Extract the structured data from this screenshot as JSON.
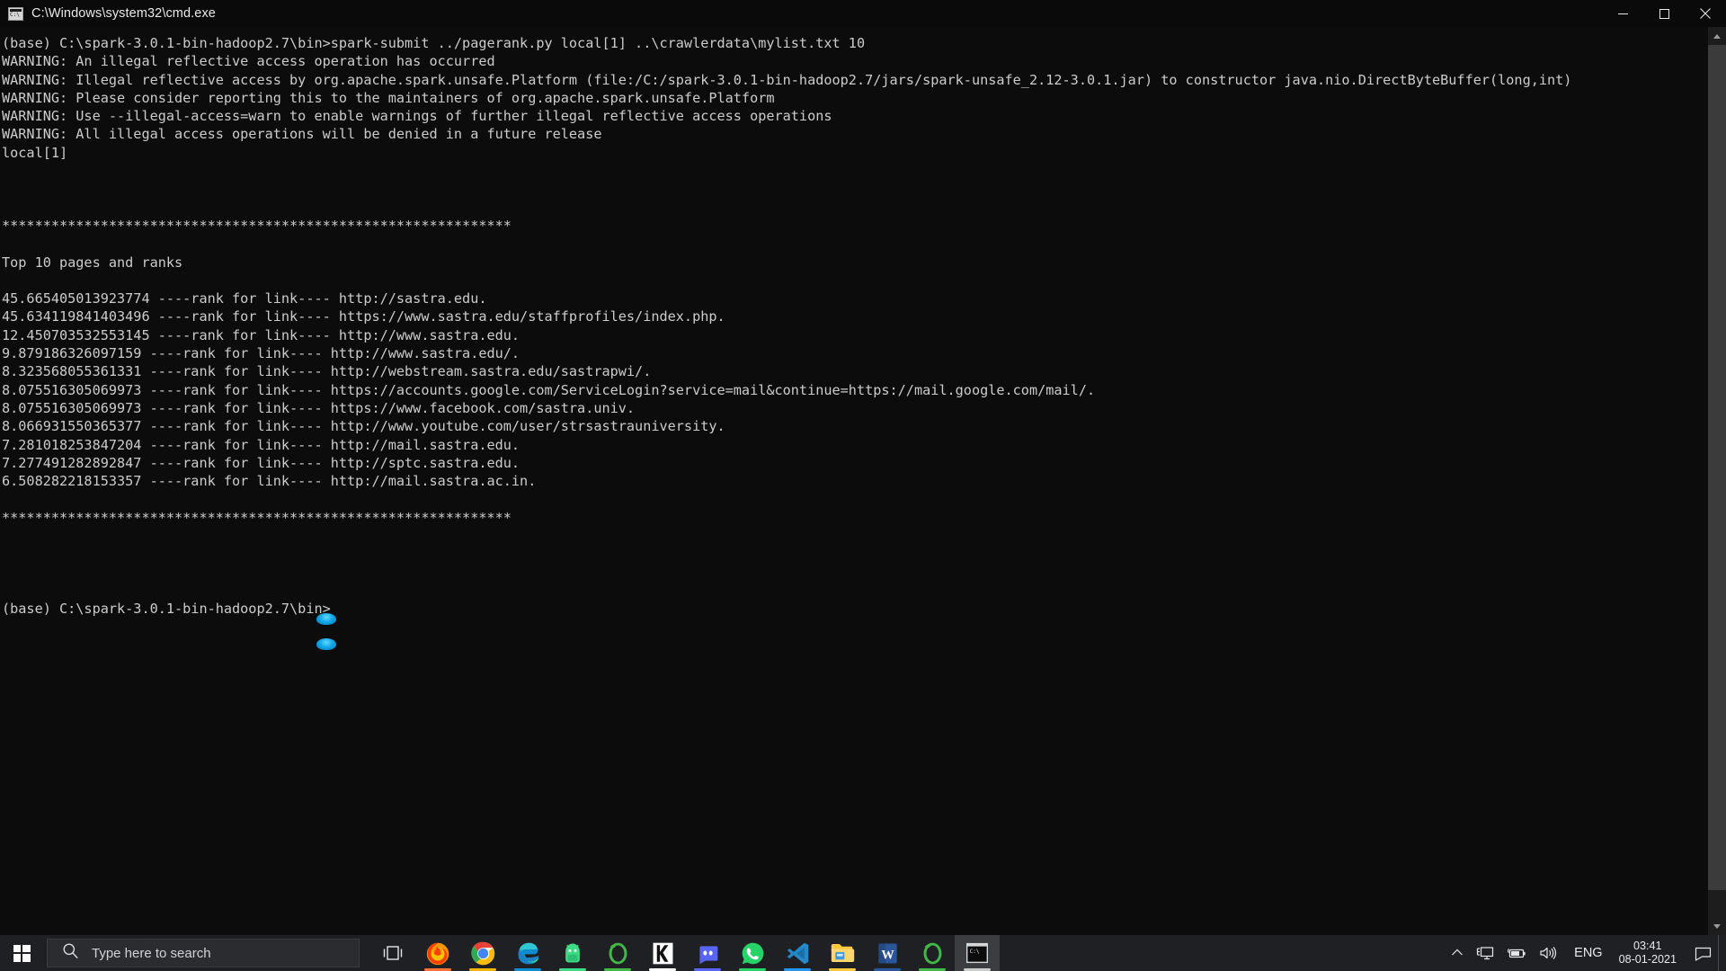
{
  "window": {
    "title": "C:\\Windows\\system32\\cmd.exe",
    "icon": "cmd-icon",
    "controls": [
      {
        "name": "minimize-button",
        "glyph": "minimize"
      },
      {
        "name": "maximize-button",
        "glyph": "maximize"
      },
      {
        "name": "close-button",
        "glyph": "close"
      }
    ]
  },
  "console": {
    "prompt_cwd": "(base) C:\\spark-3.0.1-bin-hadoop2.7\\bin>",
    "command": "spark-submit ../pagerank.py local[1] ..\\crawlerdata\\mylist.txt 10",
    "separator": "**************************************************************",
    "heading": "Top 10 pages and ranks",
    "warnings": [
      "WARNING: An illegal reflective access operation has occurred",
      "WARNING: Illegal reflective access by org.apache.spark.unsafe.Platform (file:/C:/spark-3.0.1-bin-hadoop2.7/jars/spark-unsafe_2.12-3.0.1.jar) to constructor java.nio.DirectByteBuffer(long,int)",
      "WARNING: Please consider reporting this to the maintainers of org.apache.spark.unsafe.Platform",
      "WARNING: Use --illegal-access=warn to enable warnings of further illegal reflective access operations",
      "WARNING: All illegal access operations will be denied in a future release"
    ],
    "master": "local[1]",
    "rank_separator": "----rank for link----",
    "ranks": [
      {
        "rank": "45.665405013923774",
        "link": "http://sastra.edu."
      },
      {
        "rank": "45.634119841403496",
        "link": "https://www.sastra.edu/staffprofiles/index.php."
      },
      {
        "rank": "12.450703532553145",
        "link": "http://www.sastra.edu."
      },
      {
        "rank": "9.879186326097159",
        "link": "http://www.sastra.edu/."
      },
      {
        "rank": "8.323568055361331",
        "link": "http://webstream.sastra.edu/sastrapwi/."
      },
      {
        "rank": "8.075516305069973",
        "link": "https://accounts.google.com/ServiceLogin?service=mail&continue=https://mail.google.com/mail/."
      },
      {
        "rank": "8.075516305069973",
        "link": "https://www.facebook.com/sastra.univ."
      },
      {
        "rank": "8.066931550365377",
        "link": "http://www.youtube.com/user/strsastrauniversity."
      },
      {
        "rank": "7.281018253847204",
        "link": "http://mail.sastra.edu."
      },
      {
        "rank": "7.277491282892847",
        "link": "http://sptc.sastra.edu."
      },
      {
        "rank": "6.508282218153357",
        "link": "http://mail.sastra.ac.in."
      }
    ],
    "final_prompt": "(base) C:\\spark-3.0.1-bin-hadoop2.7\\bin>"
  },
  "taskbar": {
    "start_label": "Start",
    "search_placeholder": "Type here to search",
    "task_view_label": "Task View",
    "apps": [
      {
        "name": "firefox",
        "label": "Mozilla Firefox",
        "accent": "#ff7139",
        "running": true
      },
      {
        "name": "chrome",
        "label": "Google Chrome",
        "accent": "#4285f4",
        "running": true
      },
      {
        "name": "edge",
        "label": "Microsoft Edge",
        "accent": "#0f8bd0",
        "running": true
      },
      {
        "name": "android-studio",
        "label": "Android Studio",
        "accent": "#3ddc84",
        "running": false
      },
      {
        "name": "anaconda-navigator",
        "label": "Anaconda Navigator",
        "accent": "#44b749",
        "running": false
      },
      {
        "name": "kite",
        "label": "Kite",
        "accent": "#ffffff",
        "running": false
      },
      {
        "name": "discord",
        "label": "Discord",
        "accent": "#5865f2",
        "running": false
      },
      {
        "name": "whatsapp",
        "label": "WhatsApp",
        "accent": "#25d366",
        "running": true
      },
      {
        "name": "vscode",
        "label": "Visual Studio Code",
        "accent": "#2496ed",
        "running": true
      },
      {
        "name": "file-explorer",
        "label": "File Explorer",
        "accent": "#ffc83d",
        "running": true
      },
      {
        "name": "word",
        "label": "Microsoft Word",
        "accent": "#2b579a",
        "running": true
      },
      {
        "name": "anaconda-prompt",
        "label": "Anaconda Prompt",
        "accent": "#44b749",
        "running": true
      },
      {
        "name": "command-prompt",
        "label": "C:\\Windows\\system32\\cmd.exe",
        "accent": "#cccccc",
        "running": true,
        "active": true
      }
    ],
    "tray": {
      "show_hidden_label": "Show hidden icons",
      "network_label": "Network",
      "battery_label": "Battery",
      "volume_label": "Speakers",
      "language": "ENG",
      "time": "03:41",
      "date": "08-01-2021",
      "action_center_label": "Notifications"
    }
  },
  "colors": {
    "console_bg": "#0c0c0c",
    "console_fg": "#cccccc",
    "taskbar_bg": "#1f2023",
    "titlebar_bg": "#0a0a0a"
  }
}
